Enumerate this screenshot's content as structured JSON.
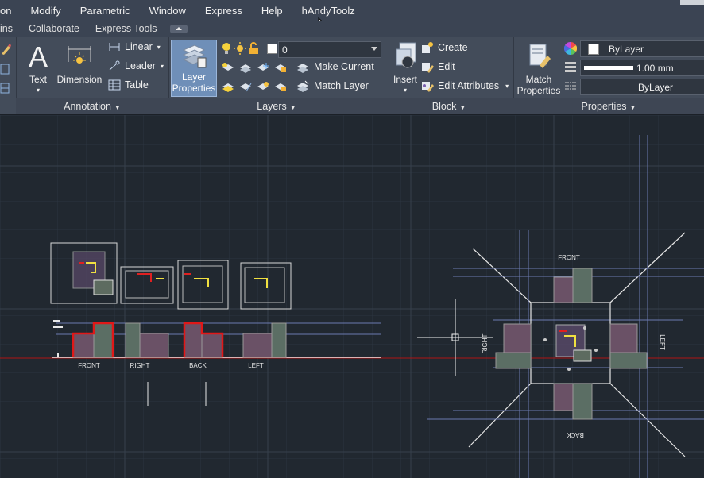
{
  "menubar": {
    "items": [
      "on",
      "Modify",
      "Parametric",
      "Window",
      "Express",
      "Help",
      "hAndyToolz"
    ]
  },
  "tabbar": {
    "items": [
      "ins",
      "Collaborate",
      "Express Tools"
    ]
  },
  "annotation": {
    "title": "Annotation",
    "text_label": "Text",
    "dimension_label": "Dimension",
    "linear_label": "Linear",
    "leader_label": "Leader",
    "table_label": "Table"
  },
  "layers": {
    "title": "Layers",
    "layer_properties_line1": "Layer",
    "layer_properties_line2": "Properties",
    "current_layer": "0",
    "make_current_label": "Make Current",
    "match_layer_label": "Match Layer"
  },
  "block": {
    "title": "Block",
    "insert_label": "Insert",
    "create_label": "Create",
    "edit_label": "Edit",
    "edit_attributes_label": "Edit Attributes"
  },
  "properties": {
    "title": "Properties",
    "match_line1": "Match",
    "match_line2": "Properties",
    "color_value": "ByLayer",
    "lineweight_value": "1.00 mm",
    "linetype_value": "ByLayer"
  },
  "drawing": {
    "views": [
      "FRONT",
      "RIGHT",
      "BACK",
      "LEFT"
    ],
    "plan_labels": {
      "top": "FRONT",
      "left": "RIGHT",
      "right": "LEFT",
      "bottom": "BACK"
    }
  },
  "colors": {
    "menubar": "#3b4453",
    "ribbon": "#434c5a",
    "canvas": "#212830",
    "active_tool": "#6f8fb8",
    "red_outline": "#e01818"
  }
}
